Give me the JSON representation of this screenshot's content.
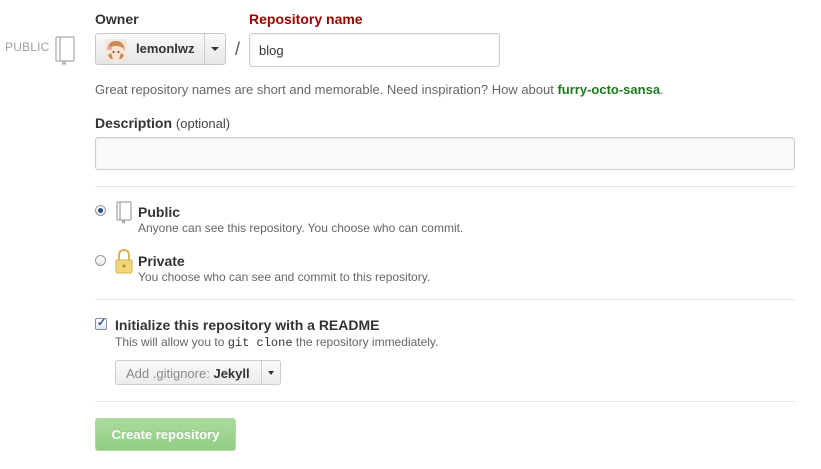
{
  "visibility_badge": "PUBLIC",
  "owner": {
    "label": "Owner",
    "name": "lemonlwz"
  },
  "repo": {
    "label": "Repository name",
    "separator": "/",
    "value": "blog"
  },
  "hint": {
    "prefix": "Great repository names are short and memorable. Need inspiration? How about ",
    "suggestion": "furry-octo-sansa",
    "suffix": "."
  },
  "description": {
    "label": "Description",
    "optional": "(optional)",
    "value": ""
  },
  "visibility": {
    "selected": "Public",
    "public": {
      "title": "Public",
      "desc": "Anyone can see this repository. You choose who can commit."
    },
    "private": {
      "title": "Private",
      "desc": "You choose who can see and commit to this repository."
    }
  },
  "init": {
    "checked": true,
    "label": "Initialize this repository with a README",
    "desc_before": "This will allow you to ",
    "desc_code": "git clone",
    "desc_after": " the repository immediately."
  },
  "gitignore": {
    "prefix": "Add .gitignore:",
    "value": "Jekyll"
  },
  "create_button": "Create repository",
  "colors": {
    "accent_red": "#990000",
    "suggestion_green": "#1f7a1f",
    "create_button": "#a9dc9b"
  }
}
